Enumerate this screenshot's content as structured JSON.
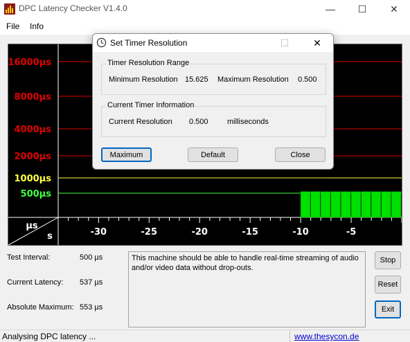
{
  "window": {
    "title": "DPC Latency Checker V1.4.0",
    "controls": [
      "—",
      "☐",
      "✕"
    ]
  },
  "menu": {
    "items": [
      "File",
      "Info"
    ]
  },
  "chart_data": {
    "type": "bar",
    "x_ticks": [
      "-30",
      "-25",
      "-20",
      "-15",
      "-10",
      "-5"
    ],
    "x_range": [
      -34,
      0
    ],
    "corner_labels": {
      "top": "µs",
      "bottom": "s"
    },
    "y_thresholds": [
      {
        "label": "16000µs",
        "value": 16000,
        "color": "#e00000"
      },
      {
        "label": "8000µs",
        "value": 8000,
        "color": "#e00000"
      },
      {
        "label": "4000µs",
        "value": 4000,
        "color": "#e00000"
      },
      {
        "label": "2000µs",
        "value": 2000,
        "color": "#e00000"
      },
      {
        "label": "1000µs",
        "value": 1000,
        "color": "#ffff40"
      },
      {
        "label": "500µs",
        "value": 500,
        "color": "#40ff40"
      }
    ],
    "bar_color": "#00e000",
    "bars": [
      {
        "x": -10,
        "value": 537
      },
      {
        "x": -9,
        "value": 537
      },
      {
        "x": -8,
        "value": 535
      },
      {
        "x": -7,
        "value": 536
      },
      {
        "x": -6,
        "value": 535
      },
      {
        "x": -5,
        "value": 535
      },
      {
        "x": -4,
        "value": 537
      },
      {
        "x": -3,
        "value": 536
      },
      {
        "x": -2,
        "value": 535
      },
      {
        "x": -1,
        "value": 535
      }
    ]
  },
  "stats": {
    "test_interval_label": "Test Interval:",
    "test_interval_value": "500 µs",
    "current_latency_label": "Current Latency:",
    "current_latency_value": "537 µs",
    "absolute_max_label": "Absolute Maximum:",
    "absolute_max_value": "553 µs"
  },
  "message": "This machine should be able to handle real-time streaming of audio and/or video data without drop-outs.",
  "buttons": {
    "stop": "Stop",
    "reset": "Reset",
    "exit": "Exit"
  },
  "statusbar": {
    "text": "Analysing DPC latency ...",
    "link": "www.thesycon.de"
  },
  "dialog": {
    "title": "Set Timer Resolution",
    "range_group": {
      "title": "Timer Resolution Range",
      "min_label": "Minimum Resolution",
      "min_value": "15.625",
      "max_label": "Maximum Resolution",
      "max_value": "0.500"
    },
    "current_group": {
      "title": "Current Timer Information",
      "label": "Current Resolution",
      "value": "0.500",
      "unit": "milliseconds"
    },
    "buttons": {
      "maximum": "Maximum",
      "default": "Default",
      "close": "Close"
    }
  }
}
